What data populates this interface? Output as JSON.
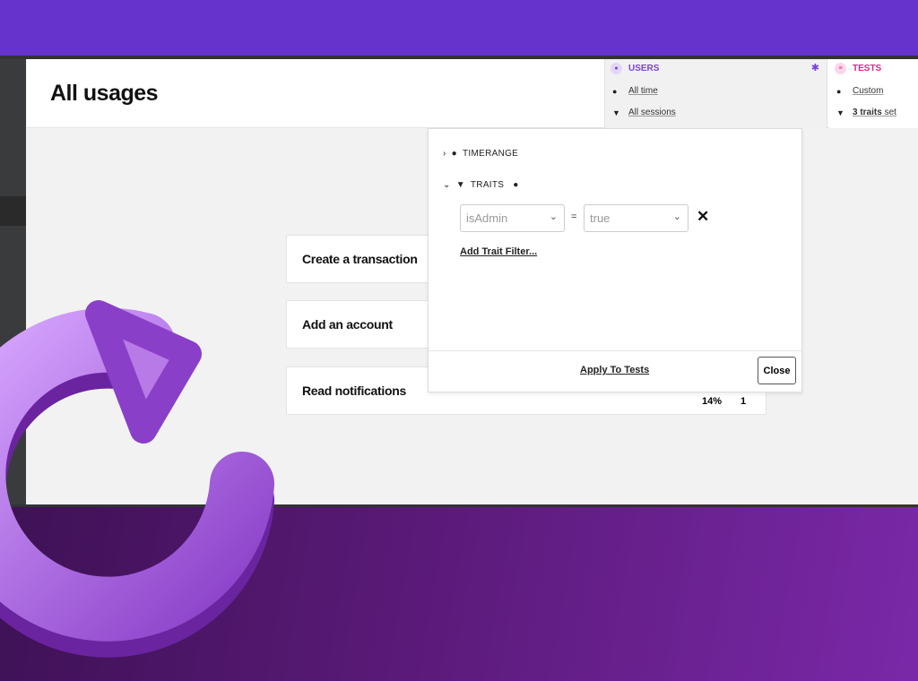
{
  "colors": {
    "background_top": "#6633cc",
    "users_accent": "#7b3fe4",
    "tests_accent": "#e91e8c",
    "arrow": "#b77ae6"
  },
  "header": {
    "title": "All usages"
  },
  "users_panel": {
    "label": "USERS",
    "icon": "user-icon",
    "settings_icon": "gear-icon",
    "timerange": "All time",
    "filter": "All sessions"
  },
  "tests_panel": {
    "label": "TESTS",
    "icon": "list-icon",
    "timerange": "Custom",
    "filter_bold": "3 traits",
    "filter_rest": " set"
  },
  "usages": [
    {
      "name": "Create a transaction"
    },
    {
      "name": "Add an account"
    },
    {
      "name": "Read notifications",
      "percent": "14%",
      "count": "1"
    }
  ],
  "dropdown": {
    "timerange_label": "TIMERANGE",
    "traits_label": "TRAITS",
    "trait_filter": {
      "key": "isAdmin",
      "operator": "=",
      "value": "true"
    },
    "add_trait": "Add Trait Filter...",
    "apply": "Apply To Tests",
    "close": "Close"
  },
  "decoration": {
    "icon": "refresh-arrow-icon"
  }
}
